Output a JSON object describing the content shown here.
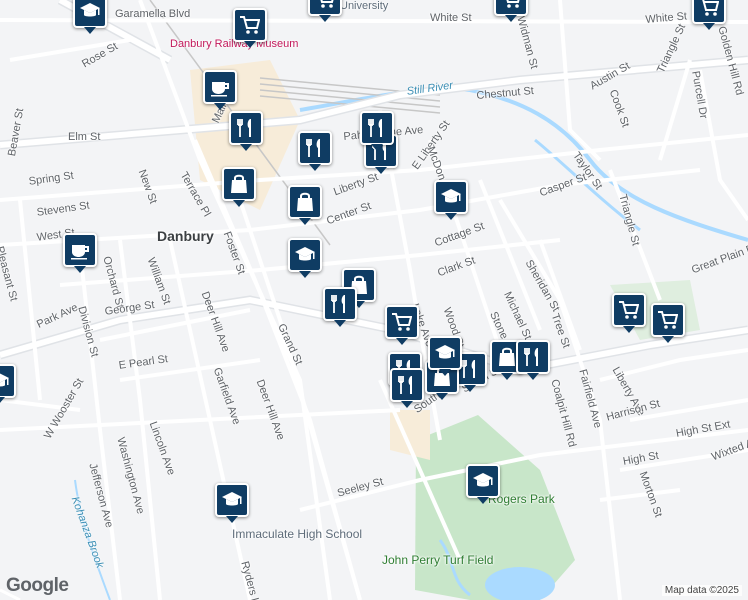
{
  "map": {
    "attribution": "Map data ©2025",
    "logo": "Google",
    "place_labels": [
      {
        "id": "danbury",
        "text": "Danbury",
        "kind": "big"
      },
      {
        "id": "museum",
        "text": "Danbury Railway Museum",
        "kind": "museum"
      },
      {
        "id": "school",
        "text": "Immaculate High School",
        "kind": "poi"
      },
      {
        "id": "park",
        "text": "Rogers Park",
        "kind": "park"
      },
      {
        "id": "turf",
        "text": "John Perry Turf Field",
        "kind": "park"
      },
      {
        "id": "river",
        "text": "Still River",
        "kind": "water"
      },
      {
        "id": "univ",
        "text": "University",
        "kind": "univ"
      },
      {
        "id": "brook",
        "text": "Kohanza Brook",
        "kind": "water"
      }
    ],
    "street_labels": [
      "Garamella Blvd",
      "Rose St",
      "White St",
      "White St",
      "Elm St",
      "Beaver St",
      "Spring St",
      "Stevens St",
      "Pahquioque Ave",
      "E Liberty St",
      "Liberty St",
      "Center St",
      "West St",
      "New St",
      "Terrace Pl",
      "Foster St",
      "William St",
      "Orchard St",
      "Pleasant St",
      "Park Ave",
      "Division St",
      "George St",
      "E Pearl St",
      "Grand St",
      "Deer Hill Ave",
      "Deer Hill Ave",
      "Garfield Ave",
      "Lincoln Ave",
      "W Wooster St",
      "Jefferson Ave",
      "Washington Ave",
      "Ryders Ln",
      "Seeley St",
      "South St",
      "South St",
      "Clark St",
      "Cottage St",
      "Casper St",
      "Taylor St",
      "Sheridan St",
      "Michael St",
      "Stone St",
      "Coalpit Hill Rd",
      "Fairfield Ave",
      "Liberty Ave",
      "Harrison St",
      "High St Ext",
      "High St",
      "Morton St",
      "Wixted Ave",
      "Triangle St",
      "Triangle St",
      "Chestnut St",
      "Austin St",
      "Cook St",
      "Widman St",
      "Purcell Dr",
      "Golden Hill Rd",
      "Main St",
      "Great Plain Rd",
      "McDonald St",
      "Lake Ave",
      "Wood St",
      "Tree St"
    ],
    "markers": [
      {
        "icon": "school-icon"
      },
      {
        "icon": "shopping-cart-icon"
      },
      {
        "icon": "shopping-cart-icon"
      },
      {
        "icon": "shopping-cart-icon"
      },
      {
        "icon": "shopping-cart-icon"
      },
      {
        "icon": "coffee-icon"
      },
      {
        "icon": "coffee-icon"
      },
      {
        "icon": "restaurant-icon"
      },
      {
        "icon": "restaurant-icon"
      },
      {
        "icon": "restaurant-icon"
      },
      {
        "icon": "restaurant-icon"
      },
      {
        "icon": "shopping-bag-icon"
      },
      {
        "icon": "shopping-bag-icon"
      },
      {
        "icon": "school-icon"
      },
      {
        "icon": "school-icon"
      },
      {
        "icon": "shopping-bag-icon"
      },
      {
        "icon": "restaurant-icon"
      },
      {
        "icon": "shopping-cart-icon"
      },
      {
        "icon": "shopping-cart-icon"
      },
      {
        "icon": "shopping-cart-icon"
      },
      {
        "icon": "restaurant-icon"
      },
      {
        "icon": "restaurant-icon"
      },
      {
        "icon": "restaurant-icon"
      },
      {
        "icon": "shopping-bag-icon"
      },
      {
        "icon": "shopping-bag-icon"
      },
      {
        "icon": "restaurant-icon"
      },
      {
        "icon": "school-icon"
      },
      {
        "icon": "school-icon"
      },
      {
        "icon": "school-icon"
      },
      {
        "icon": "school-icon"
      }
    ],
    "colors": {
      "marker": "#0f3c63",
      "road": "#ffffff",
      "highway": "#e8eaed",
      "park": "#c8e6c9",
      "water": "#aadaff",
      "land": "#f3f4f6"
    }
  }
}
